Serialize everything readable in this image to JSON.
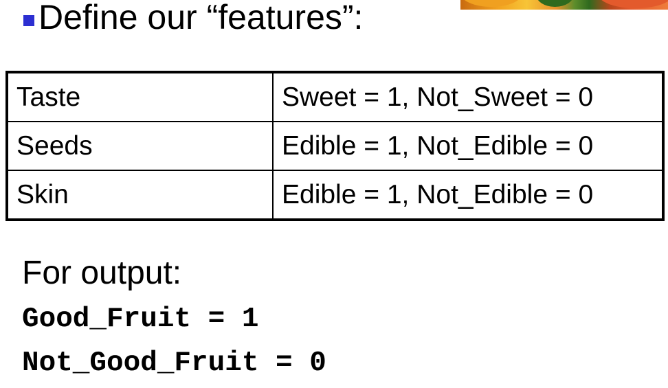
{
  "heading": {
    "text": "Define our “features”:"
  },
  "features_table": {
    "rows": [
      {
        "feature": "Taste",
        "encoding": "Sweet = 1, Not_Sweet = 0"
      },
      {
        "feature": "Seeds",
        "encoding": "Edible = 1, Not_Edible = 0"
      },
      {
        "feature": "Skin",
        "encoding": "Edible = 1, Not_Edible = 0"
      }
    ]
  },
  "output": {
    "label": "For output:",
    "lines": [
      "Good_Fruit = 1",
      "Not_Good_Fruit = 0"
    ]
  },
  "colors": {
    "bullet": "#2c2fd1",
    "text": "#000000",
    "background": "#ffffff"
  }
}
